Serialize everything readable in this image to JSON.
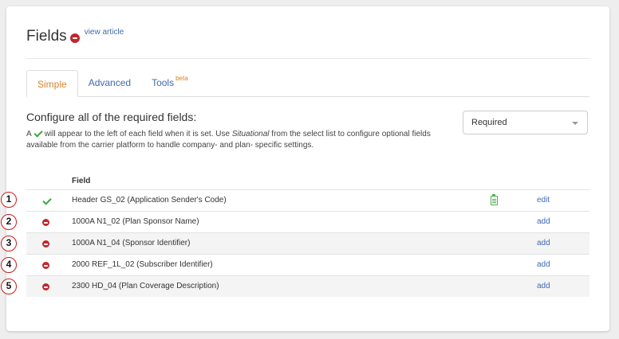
{
  "header": {
    "title": "Fields",
    "view_article": "view article"
  },
  "tabs": [
    {
      "label": "Simple",
      "active": true
    },
    {
      "label": "Advanced",
      "active": false
    },
    {
      "label": "Tools",
      "badge": "beta",
      "active": false
    }
  ],
  "section": {
    "heading": "Configure all of the required fields:",
    "desc_part1": "A",
    "desc_part2": "will appear to the left of each field when it is set. Use",
    "desc_italic": "Situational",
    "desc_part3": "from the select list to configure optional fields available from the carrier platform to handle company- and plan- specific settings."
  },
  "select": {
    "value": "Required"
  },
  "table": {
    "column_header": "Field",
    "rows": [
      {
        "marker": "1",
        "status": "set",
        "field": "Header GS_02 (Application Sender's Code)",
        "action": "edit",
        "has_clipboard": true
      },
      {
        "marker": "2",
        "status": "unset",
        "field": "1000A N1_02 (Plan Sponsor Name)",
        "action": "add"
      },
      {
        "marker": "3",
        "status": "unset",
        "field": "1000A N1_04 (Sponsor Identifier)",
        "action": "add"
      },
      {
        "marker": "4",
        "status": "unset",
        "field": "2000 REF_1L_02 (Subscriber Identifier)",
        "action": "add"
      },
      {
        "marker": "5",
        "status": "unset",
        "field": "2300 HD_04 (Plan Coverage Description)",
        "action": "add"
      }
    ]
  },
  "colors": {
    "accent_link": "#3f6ab3",
    "active_tab": "#d9822b",
    "stop_red": "#c0282d",
    "check_green": "#3aa83a",
    "marker_red": "#d11a1a"
  }
}
